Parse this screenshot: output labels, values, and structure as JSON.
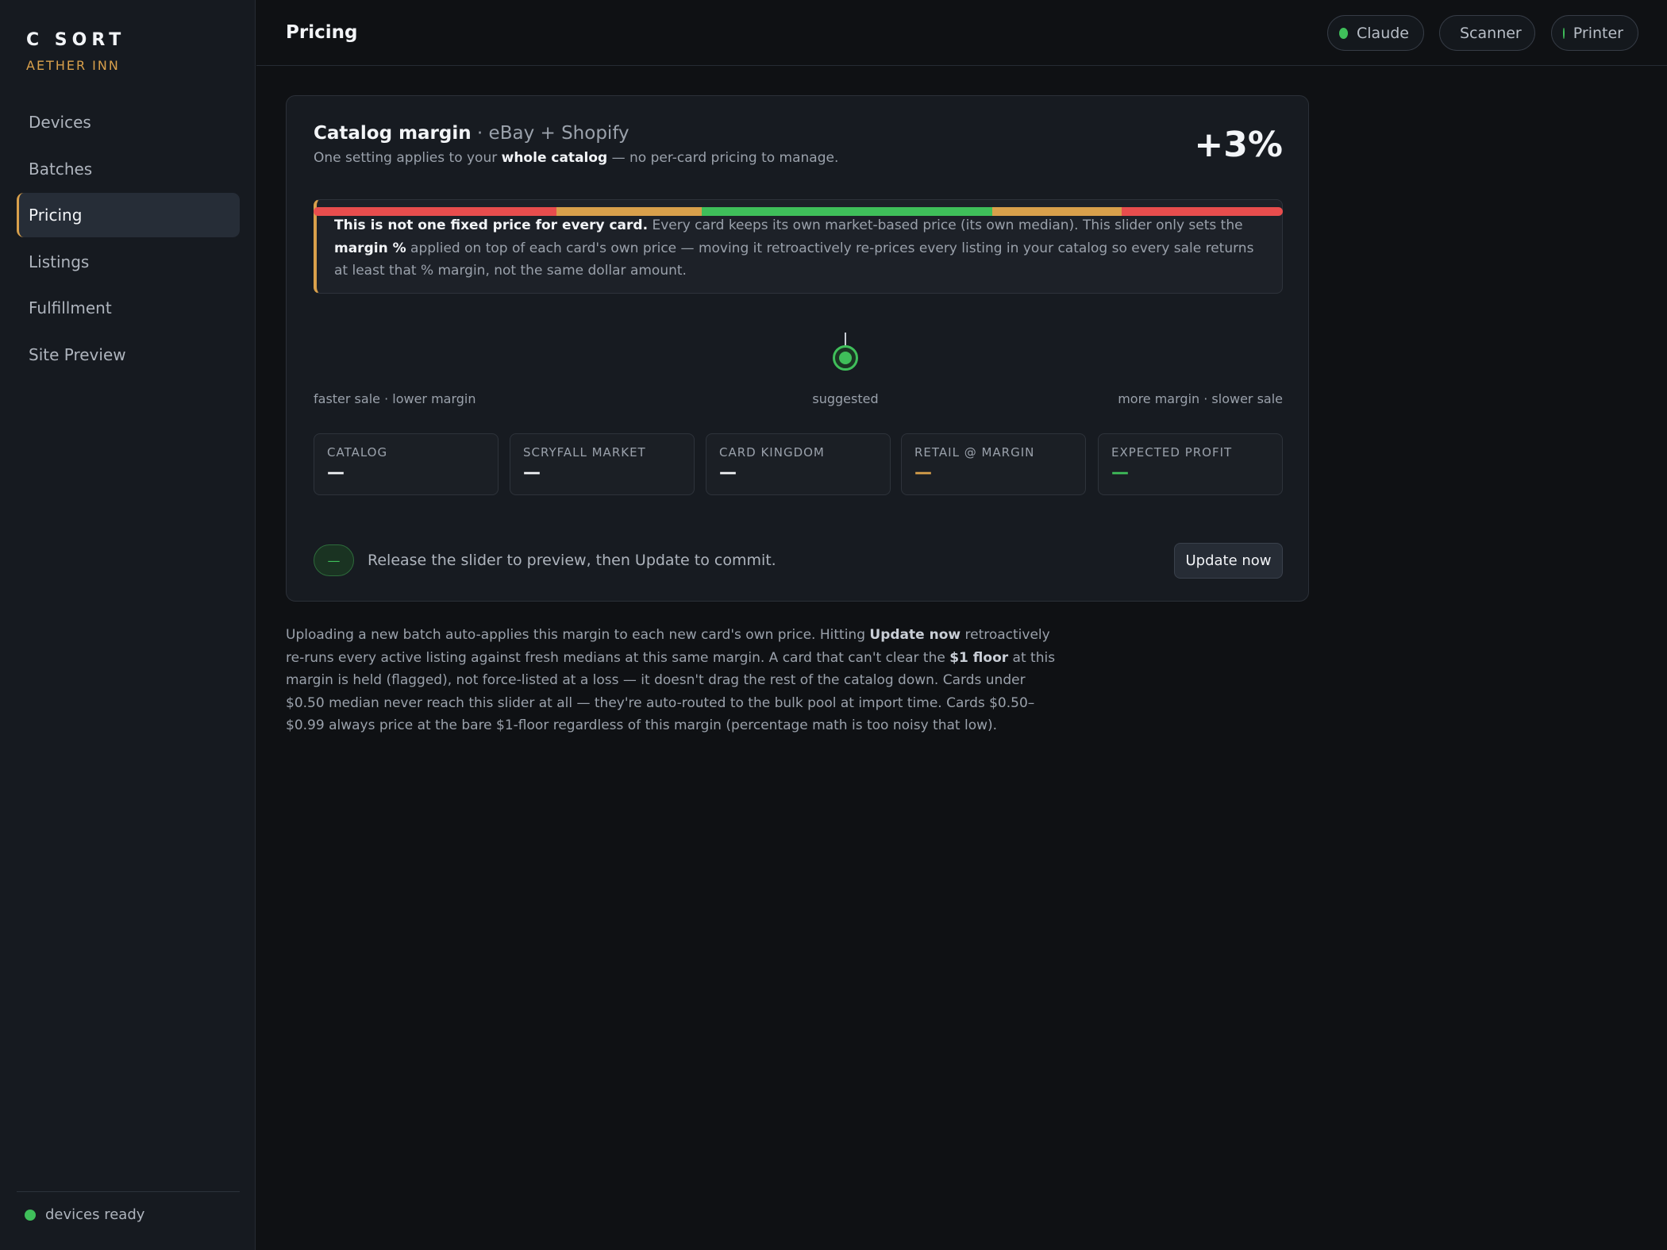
{
  "sidebar": {
    "brand": "C SORT",
    "brand_sub": "AETHER INN",
    "items": [
      {
        "label": "Devices"
      },
      {
        "label": "Batches"
      },
      {
        "label": "Pricing"
      },
      {
        "label": "Listings"
      },
      {
        "label": "Fulfillment"
      },
      {
        "label": "Site Preview"
      }
    ],
    "active_item": "Pricing",
    "status": "devices ready"
  },
  "header": {
    "title": "Pricing",
    "pills": [
      {
        "label": "Claude",
        "status_color": "#3fbf5a"
      },
      {
        "label": "Scanner",
        "status_color": "#3fbf5a"
      },
      {
        "label": "Printer",
        "status_color": "#3fbf5a"
      }
    ]
  },
  "card": {
    "title_bold": "Catalog margin",
    "title_rest": " · eBay + Shopify",
    "subtitle_pre": "One setting applies to your ",
    "subtitle_em": "whole catalog",
    "subtitle_post": " — no per-card pricing to manage.",
    "margin_value": "+3%",
    "notice": {
      "lead": "This is not one fixed price for every card.",
      "text1": " Every card keeps its own market-based price (its own median). This slider only sets the ",
      "em": "margin %",
      "text2": " applied on top of each card's own price — moving it retroactively re-prices every listing in your catalog so every sale returns at least that % margin, not the same dollar amount."
    },
    "slider": {
      "label_left": "faster sale · lower margin",
      "label_center": "suggested",
      "label_right": "more margin · slower sale",
      "position_fraction": 0.55,
      "colors": {
        "low": "#e84d4d",
        "mid": "#d9a04b",
        "good": "#3fbf5a"
      }
    },
    "stats": [
      {
        "label": "CATALOG",
        "value": "—",
        "color": "#f2f4f7"
      },
      {
        "label": "SCRYFALL MARKET",
        "value": "—",
        "color": "#f2f4f7"
      },
      {
        "label": "CARD KINGDOM",
        "value": "—",
        "color": "#f2f4f7"
      },
      {
        "label": "RETAIL @ MARGIN",
        "value": "—",
        "color": "#d9a04b"
      },
      {
        "label": "EXPECTED PROFIT",
        "value": "—",
        "color": "#3fbf5a"
      }
    ],
    "preview_badge": "—",
    "preview_text": "Release the slider to preview, then Update to commit.",
    "update_button": "Update now"
  },
  "footnote": {
    "t1": "Uploading a new batch auto-applies this margin to each new card's own price. Hitting ",
    "em1": "Update now",
    "t2": " retroactively re-runs every active listing against fresh medians at this same margin. A card that can't clear the ",
    "em2": "$1 floor",
    "t3": " at this margin is held (flagged), not force-listed at a loss — it doesn't drag the rest of the catalog down. Cards under $0.50 median never reach this slider at all — they're auto-routed to the bulk pool at import time. Cards $0.50–$0.99 always price at the bare $1-floor regardless of this margin (percentage math is too noisy that low)."
  }
}
